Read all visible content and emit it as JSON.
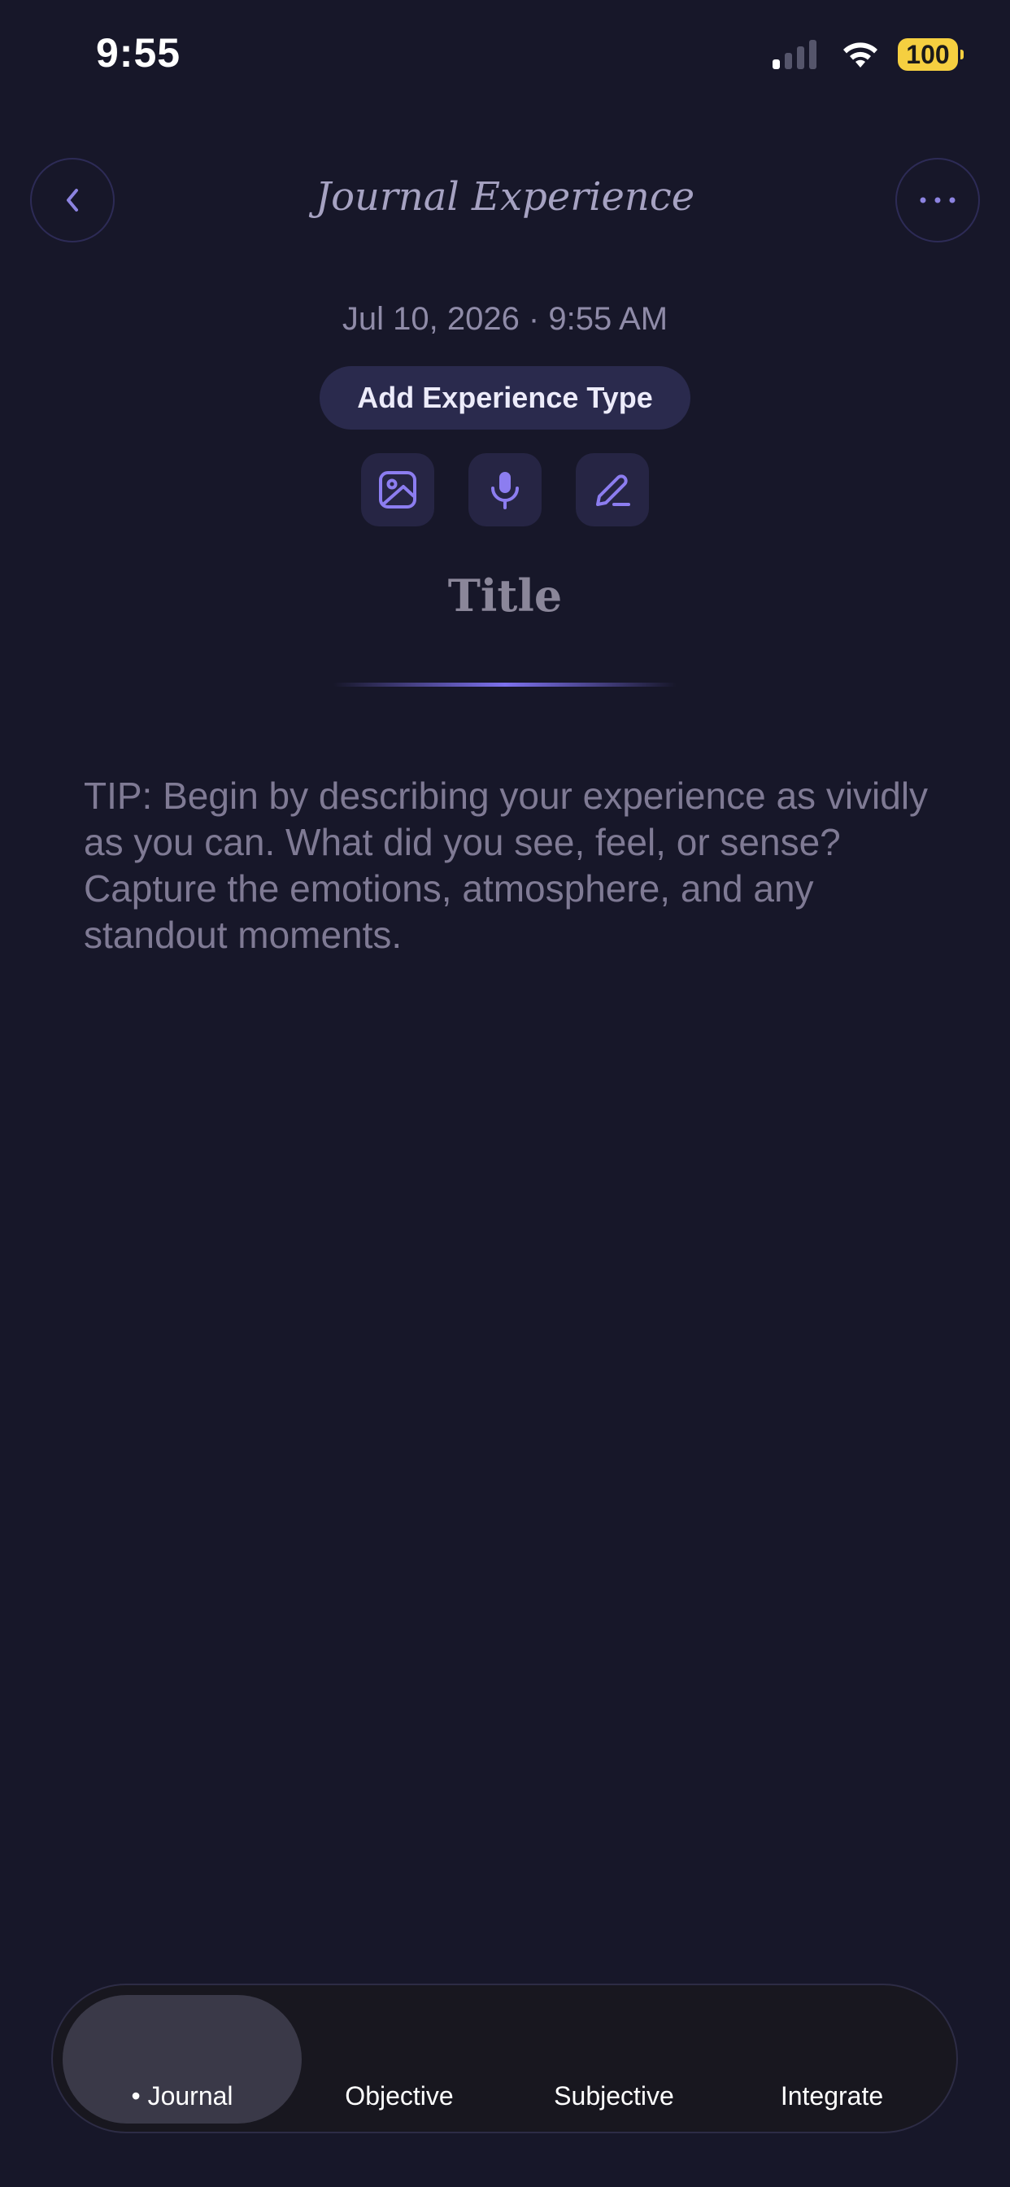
{
  "status_bar": {
    "time": "9:55",
    "battery": "100",
    "signal_icon": "cellular-signal-icon",
    "wifi_icon": "wifi-icon",
    "battery_icon": "battery-icon"
  },
  "header": {
    "title": "Journal Experience",
    "back_icon": "chevron-left-icon",
    "more_icon": "ellipsis-icon"
  },
  "entry": {
    "datetime": "Jul 10, 2026 · 9:55 AM",
    "add_type_label": "Add Experience Type",
    "tools": [
      "image-icon",
      "microphone-icon",
      "pen-icon"
    ],
    "title_placeholder": "Title",
    "tip": "TIP: Begin by describing your experience as vividly as you can. What did you see, feel, or sense? Capture the emotions, atmosphere, and any standout moments."
  },
  "tabs": [
    {
      "label": "• Journal",
      "active": true
    },
    {
      "label": "Objective",
      "active": false
    },
    {
      "label": "Subjective",
      "active": false
    },
    {
      "label": "Integrate",
      "active": false
    }
  ],
  "colors": {
    "background": "#171729",
    "accent": "#7d71ee",
    "battery": "#f5cf40"
  }
}
